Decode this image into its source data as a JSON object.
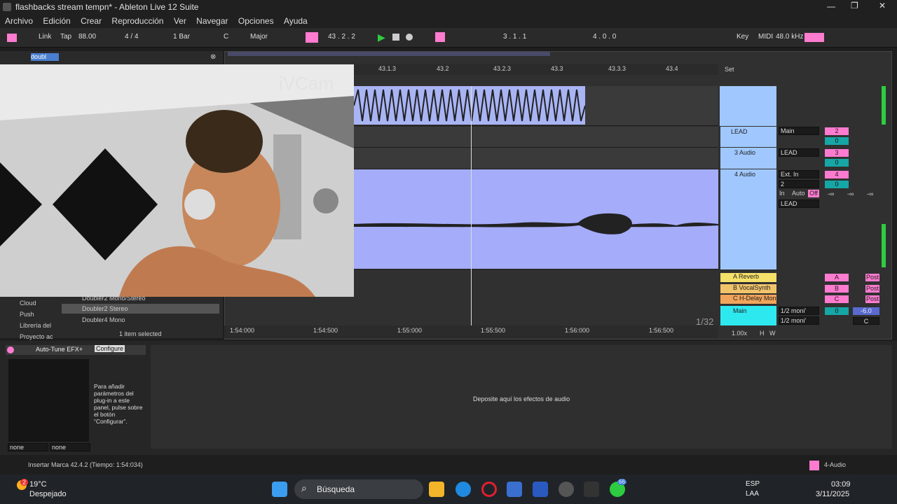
{
  "window": {
    "title": "flashbacks stream tempn* - Ableton Live 12 Suite"
  },
  "menu": [
    "Archivo",
    "Edición",
    "Crear",
    "Reproducción",
    "Ver",
    "Navegar",
    "Opciones",
    "Ayuda"
  ],
  "transport": {
    "link": "Link",
    "tap": "Tap",
    "tempo": "88.00",
    "signature": "4 / 4",
    "quantize": "1 Bar",
    "key": "C",
    "scale": "Major",
    "position": "43 .  2 .  2",
    "loop_start": "3 .  1 .  1",
    "loop_len": "4 .  0 .  0",
    "key_label": "Key",
    "midi_label": "MIDI",
    "sample_rate": "48.0 kHz"
  },
  "browser": {
    "search_value": "doubl",
    "side": [
      "Cloud",
      "Push",
      "Librería del",
      "Proyecto ac"
    ],
    "items": [
      "Doubler2 Mono/Stereo",
      "Doubler2 Stereo",
      "Doubler4 Mono"
    ],
    "selected_count": "1 item selected"
  },
  "ruler": {
    "ticks": [
      "43.1.3",
      "43.2",
      "43.2.3",
      "43.3",
      "43.3.3",
      "43.4"
    ]
  },
  "set_label": "Set",
  "tracks": [
    {
      "name": "LEAD",
      "out": "Main",
      "vol": "2",
      "pan": "0"
    },
    {
      "name": "3 Audio",
      "out": "LEAD",
      "vol": "3",
      "pan": "0"
    },
    {
      "name": "4 Audio",
      "out": "Ext. In",
      "ch": "2",
      "vol": "4",
      "pan": "0",
      "monitor_in": "In",
      "monitor_auto": "Auto",
      "monitor_off": "Off",
      "send_to": "LEAD",
      "neg": "-∞"
    }
  ],
  "returns": [
    {
      "name": "A Reverb",
      "letter": "A",
      "post": "Post"
    },
    {
      "name": "B VocalSynth",
      "letter": "B",
      "post": "Post"
    },
    {
      "name": "C H-Delay Mon",
      "letter": "C",
      "post": "Post"
    }
  ],
  "main": {
    "name": "Main",
    "out1": "1/2 moni’",
    "out2": "1/2 moni’",
    "pan": "0",
    "vol": "-6.0",
    "c": "C"
  },
  "bottom_times": [
    "1:54:000",
    "1:54:500",
    "1:55:000",
    "1:55:500",
    "1:56:000",
    "1:56:500"
  ],
  "grid": "1/32",
  "zoom": "1.00x",
  "hw": [
    "H",
    "W"
  ],
  "device": {
    "name": "Auto-Tune EFX+",
    "configure": "Configure",
    "help": "Para añadir parámetros del plug-in a este panel, pulse sobre el botón “Configurar”.",
    "sel1": "none",
    "sel2": "none",
    "drop": "Deposite aquí los efectos de audio"
  },
  "status": {
    "text": "Insertar Marca 42.4.2 (Tiempo: 1:54:034)",
    "track": "4-Audio"
  },
  "webcam_text": "iVCam",
  "taskbar": {
    "temp": "19°C",
    "weather": "Despejado",
    "badge": "2",
    "search": "Búsqueda",
    "lang1": "ESP",
    "lang2": "LAA",
    "time": "03:09",
    "date": "3/11/2025",
    "notif": "66"
  },
  "colors": {
    "accent": "#ff7bd0",
    "clip": "#a9b4f5",
    "teal": "#16a6a6",
    "main": "#2ee8f0"
  }
}
